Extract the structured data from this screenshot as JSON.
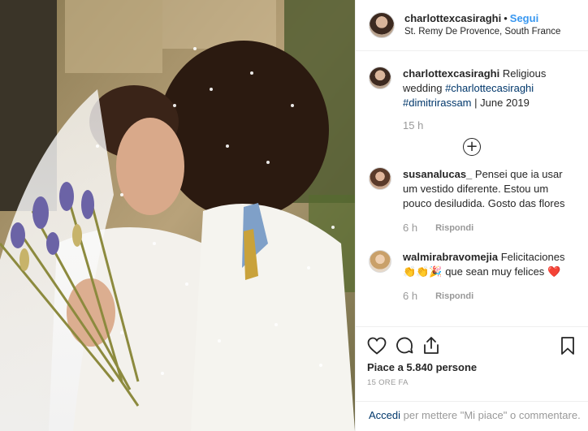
{
  "post": {
    "username": "charlottexcasiraghi",
    "separator": "•",
    "follow_label": "Segui",
    "location": "St. Remy De Provence, South France"
  },
  "caption": {
    "username": "charlottexcasiraghi",
    "text_1": "Religious wedding",
    "hashtag_1": "#charlottecasiraghi",
    "hashtag_2": "#dimitrirassam",
    "text_2": "| June 2019",
    "time": "15 h"
  },
  "load_more_label": "+",
  "comments": [
    {
      "username": "susanalucas_",
      "text": "Pensei que ia usar um vestido diferente. Estou um pouco desiludida. Gosto das flores",
      "time": "6 h",
      "reply_label": "Rispondi"
    },
    {
      "username": "walmirabravomejia",
      "text": "Felicitaciones",
      "emoji": "👏👏🎉",
      "text_2": "que sean muy felices",
      "heart": "❤️",
      "time": "6 h",
      "reply_label": "Rispondi"
    }
  ],
  "actions": {
    "likes": "Piace a 5.840 persone",
    "ago": "15 ORE FA"
  },
  "footer": {
    "login": "Accedi",
    "rest": " per mettere \"Mi piace\" o commentare."
  },
  "colors": {
    "link_blue": "#3897f0",
    "hashtag": "#00376b",
    "muted": "#999999"
  },
  "icons": [
    "heart-icon",
    "comment-icon",
    "share-icon",
    "bookmark-icon",
    "add-icon"
  ]
}
